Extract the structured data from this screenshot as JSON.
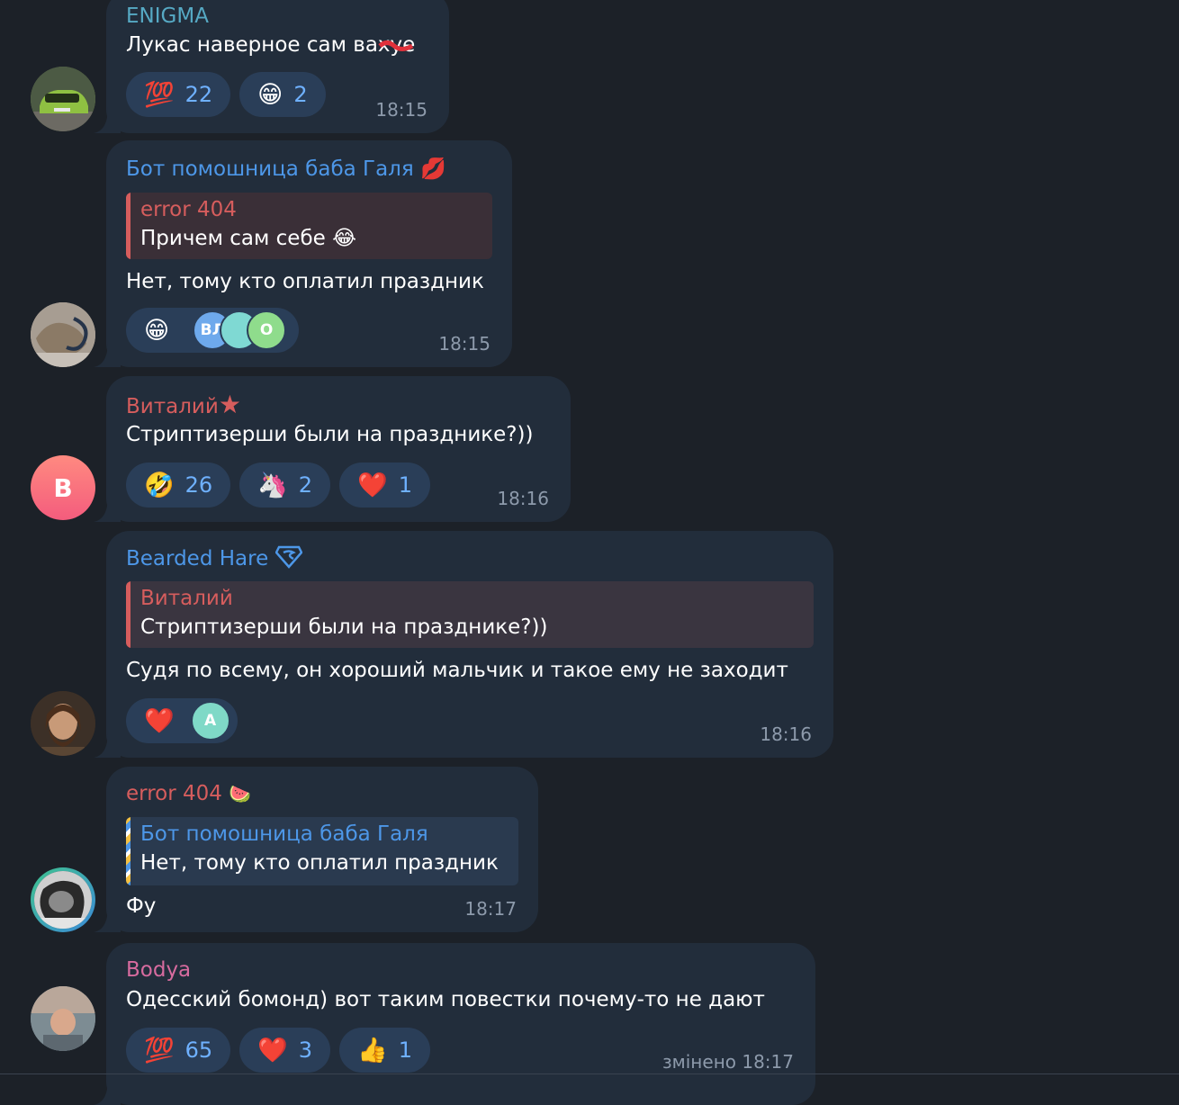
{
  "messages": [
    {
      "sender": "ENIGMA",
      "text": "Лукас наверное сам вахуе",
      "reactions": [
        {
          "emoji": "💯",
          "count": "22"
        },
        {
          "emoji": "😁",
          "count": "2"
        }
      ],
      "time": "18:15"
    },
    {
      "sender": "Бот помошница баба Галя",
      "sender_badge": "💋",
      "reply": {
        "name": "error 404",
        "text": "Причем сам себе 😂"
      },
      "text": "Нет, тому кто оплатил праздник",
      "reaction_emoji": "😁",
      "reaction_avatars": [
        "ВЛ",
        "",
        "О"
      ],
      "time": "18:15"
    },
    {
      "sender": "Виталий",
      "sender_badge": "★",
      "avatar_letter": "В",
      "text": "Стриптизерши были на празднике?))",
      "reactions": [
        {
          "emoji": "🤣",
          "count": "26"
        },
        {
          "emoji": "🦄",
          "count": "2"
        },
        {
          "emoji": "❤️",
          "count": "1"
        }
      ],
      "time": "18:16"
    },
    {
      "sender": "Bearded Hare",
      "sender_badge": "🛡",
      "reply": {
        "name": "Виталий",
        "text": "Стриптизерши были на празднике?))"
      },
      "text": "Судя по всему, он хороший мальчик и такое ему не заходит",
      "reaction_emoji": "❤️",
      "reaction_avatars": [
        "А"
      ],
      "time": "18:16"
    },
    {
      "sender": "error 404",
      "sender_badge": "🍉",
      "reply": {
        "name": "Бот помошница баба Галя",
        "text": "Нет, тому кто оплатил праздник"
      },
      "text": "Фу",
      "time": "18:17"
    },
    {
      "sender": "Bodya",
      "text": "Одесский бомонд) вот таким повестки почему-то не дают",
      "reactions": [
        {
          "emoji": "💯",
          "count": "65"
        },
        {
          "emoji": "❤️",
          "count": "3"
        },
        {
          "emoji": "👍",
          "count": "1"
        }
      ],
      "time": "змінено 18:17"
    }
  ],
  "colors": {
    "background": "#1c2128",
    "bubble": "#222d3b",
    "reaction_pill": "#2a3e58",
    "time": "#8d9aab",
    "name_teal": "#56a9c4",
    "name_blue": "#4d97e8",
    "name_red": "#d65d5d",
    "name_pink": "#d76b9f"
  }
}
